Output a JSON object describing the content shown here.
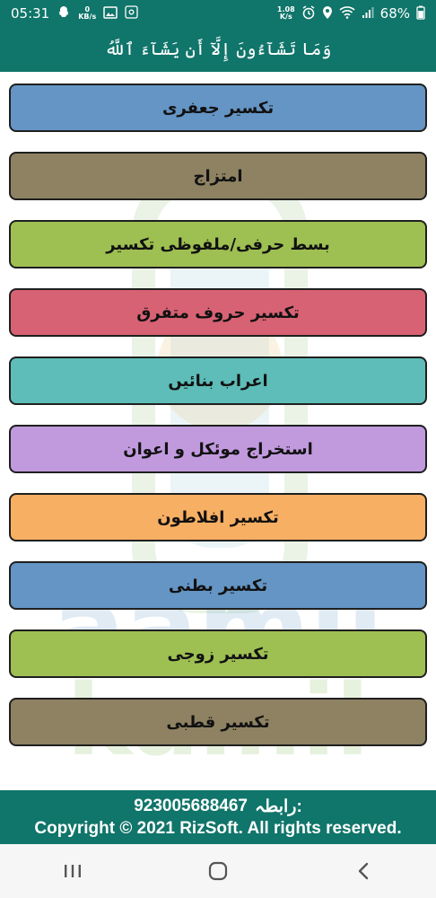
{
  "status_bar": {
    "time": "05:31",
    "speed_value": "0",
    "speed_unit": "KB/s",
    "speed_value_right": "1.08",
    "speed_unit_right": "K/s",
    "battery": "68%"
  },
  "app_bar": {
    "title": "وَمَا تَشَآءُونَ إِلَّآ أَن يَشَآءَ ٱللَّهُ"
  },
  "menu": {
    "items": [
      {
        "label": "تکسیر جعفری",
        "color": "#6495c4"
      },
      {
        "label": "امتزاج",
        "color": "#8e8262"
      },
      {
        "label": "بسط حرفی/ملفوظی تکسیر",
        "color": "#9ebf52"
      },
      {
        "label": "تکسیر حروف متفرق",
        "color": "#d76273"
      },
      {
        "label": "اعراب بنائیں",
        "color": "#5ebdb8"
      },
      {
        "label": "استخراج موئکل و اعوان",
        "color": "#c19ade"
      },
      {
        "label": "تکسیر افلاطون",
        "color": "#f7af63"
      },
      {
        "label": "تکسیر بطنی",
        "color": "#6495c4"
      },
      {
        "label": "تکسیر زوجی",
        "color": "#9ebf52"
      },
      {
        "label": "تکسیر قطبی",
        "color": "#8e8262"
      }
    ]
  },
  "watermark": {
    "line1": "aamil",
    "line2": "kamil"
  },
  "footer": {
    "contact_label": "رابطہ:",
    "contact_number": "923005688467",
    "copyright": "Copyright © 2021 RizSoft. All rights reserved."
  },
  "colors": {
    "primary": "#10756a"
  }
}
